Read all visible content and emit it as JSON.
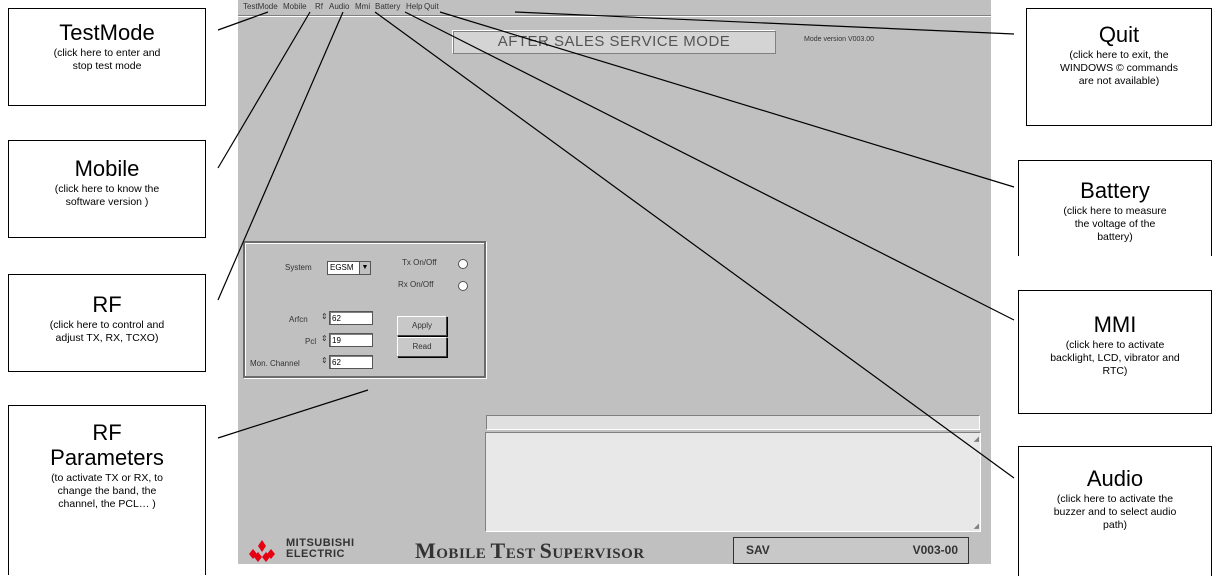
{
  "menu": {
    "items": [
      "TestMode",
      "Mobile",
      "Rf",
      "Audio",
      "Mmi",
      "Battery",
      "Help",
      "Quit"
    ]
  },
  "app": {
    "mode_title": "AFTER SALES SERVICE MODE",
    "mode_version": "Mode version V003.00",
    "rf": {
      "system_label": "System",
      "system_value": "EGSM",
      "tx_label": "Tx On/Off",
      "rx_label": "Rx On/Off",
      "arfcn_label": "Arfcn",
      "arfcn_value": "62",
      "pcl_label": "Pcl",
      "pcl_value": "19",
      "mon_channel_label": "Mon. Channel",
      "mon_channel_value": "62",
      "apply_label": "Apply",
      "read_label": "Read"
    },
    "brand_line1": "MITSUBISHI",
    "brand_line2": "ELECTRIC",
    "product_title_parts": [
      "M",
      "OBILE ",
      "T",
      "EST ",
      "S",
      "UPERVISOR"
    ],
    "status_left": "SAV",
    "status_right": "V003-00"
  },
  "callouts": {
    "testmode": {
      "title": "TestMode",
      "desc": "(click here to enter and stop test mode"
    },
    "mobile": {
      "title": "Mobile",
      "desc": "(click here to know the software version )"
    },
    "rf": {
      "title": "RF",
      "desc": "(click here to control and adjust TX, RX, TCXO)"
    },
    "rfparams": {
      "title": "RF Parameters",
      "desc": "(to activate TX or RX, to change the band, the channel, the PCL… )"
    },
    "quit": {
      "title": "Quit",
      "desc": "(click here to exit, the WINDOWS © commands are not available)"
    },
    "battery": {
      "title": "Battery",
      "desc": "(click here to measure the voltage of the battery)"
    },
    "mmi": {
      "title": "MMI",
      "desc": "(click here to activate backlight, LCD, vibrator and RTC)"
    },
    "audio": {
      "title": "Audio",
      "desc": "(click here to activate the buzzer and to select audio path)"
    }
  },
  "colors": {
    "app_bg": "#c0c0c0",
    "logo_red": "#e60012"
  }
}
